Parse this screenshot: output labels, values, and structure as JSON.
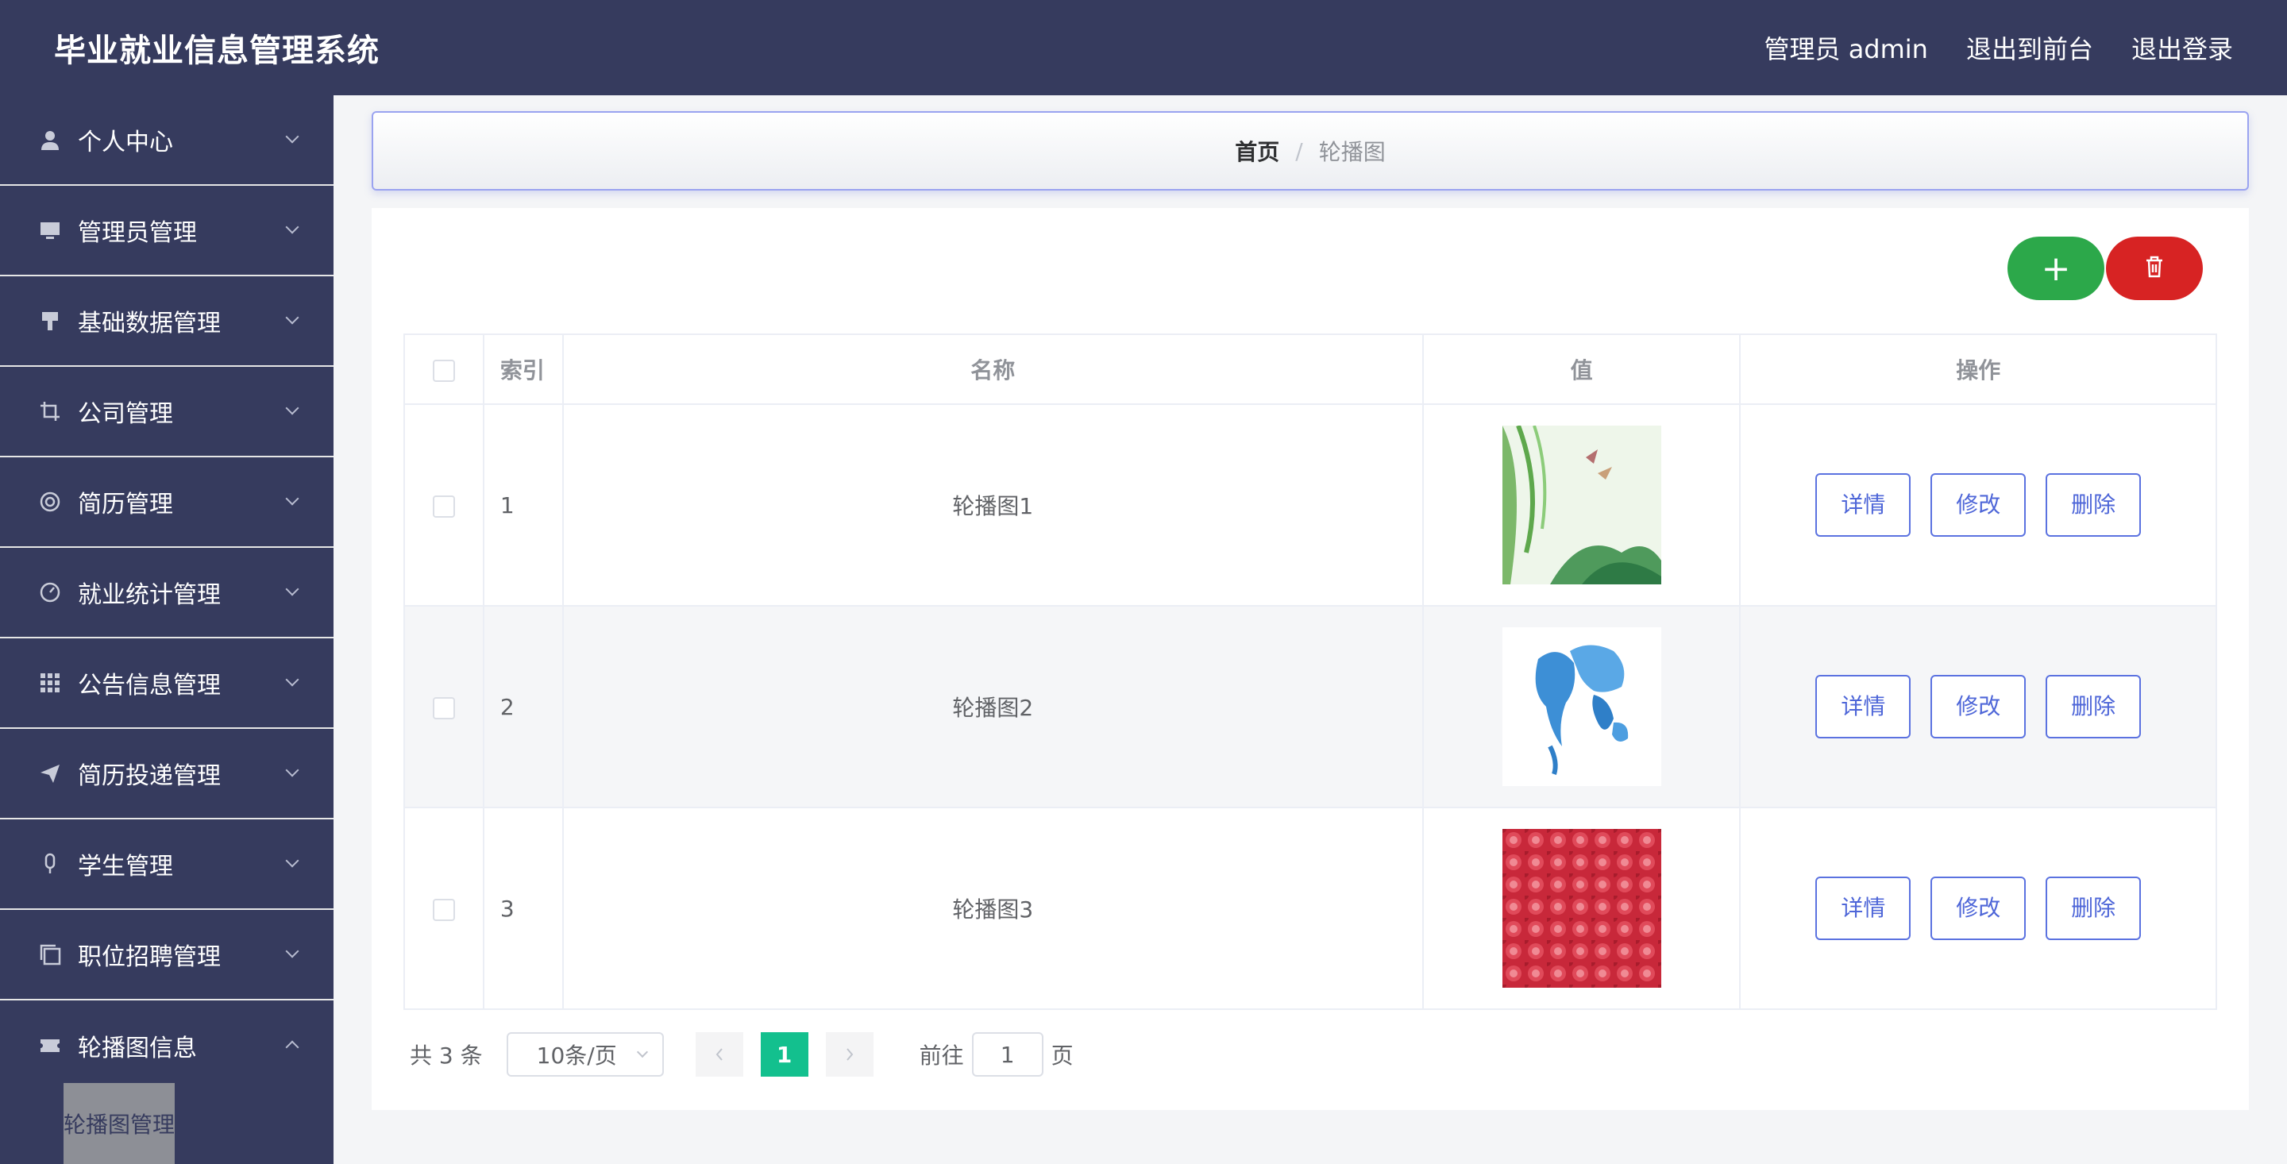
{
  "header": {
    "title": "毕业就业信息管理系统",
    "user_label": "管理员 admin",
    "front_link": "退出到前台",
    "logout_link": "退出登录"
  },
  "sidebar": {
    "items": [
      {
        "label": "个人中心",
        "icon": "user-icon"
      },
      {
        "label": "管理员管理",
        "icon": "monitor-icon"
      },
      {
        "label": "基础数据管理",
        "icon": "brush-icon"
      },
      {
        "label": "公司管理",
        "icon": "crop-icon"
      },
      {
        "label": "简历管理",
        "icon": "lifebuoy-icon"
      },
      {
        "label": "就业统计管理",
        "icon": "gauge-icon"
      },
      {
        "label": "公告信息管理",
        "icon": "grid-icon"
      },
      {
        "label": "简历投递管理",
        "icon": "send-icon"
      },
      {
        "label": "学生管理",
        "icon": "microphone-icon"
      },
      {
        "label": "职位招聘管理",
        "icon": "copy-icon"
      },
      {
        "label": "轮播图信息",
        "icon": "ticket-icon"
      }
    ],
    "sub_item": "轮播图管理"
  },
  "breadcrumb": {
    "home": "首页",
    "separator": "/",
    "current": "轮播图"
  },
  "toolbar": {
    "add_label": "+"
  },
  "table": {
    "headers": [
      "索引",
      "名称",
      "值",
      "操作"
    ],
    "rows": [
      {
        "index": "1",
        "name": "轮播图1",
        "image": "green landscape painting"
      },
      {
        "index": "2",
        "name": "轮播图2",
        "image": "blue world map"
      },
      {
        "index": "3",
        "name": "轮播图3",
        "image": "red rose pattern"
      }
    ],
    "actions": {
      "detail": "详情",
      "edit": "修改",
      "delete": "删除"
    }
  },
  "pagination": {
    "total": "共 3 条",
    "page_size": "10条/页",
    "current_page": "1",
    "goto_label": "前往",
    "goto_value": "1",
    "page_suffix": "页"
  },
  "colors": {
    "header_bg": "#363b5e",
    "add_button": "#2ca84a",
    "delete_button": "#d72323",
    "action_border": "#5b72e0",
    "active_page": "#13c08e"
  }
}
